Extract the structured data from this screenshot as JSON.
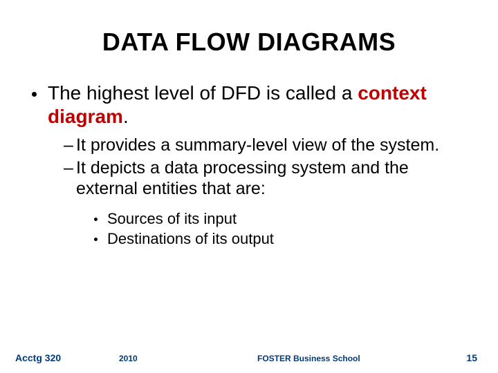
{
  "title": "DATA FLOW DIAGRAMS",
  "bullet1_pre": "The highest level of DFD is called a ",
  "bullet1_emph": "context diagram",
  "bullet1_post": ".",
  "sub": {
    "dash": "–",
    "item1": "It provides a summary-level view of the system.",
    "item2": "It depicts a data processing system and the external entities that are:"
  },
  "subsub": {
    "item1": "Sources of its input",
    "item2": "Destinations of its output"
  },
  "footer": {
    "course": "Acctg 320",
    "year": "2010",
    "school": "FOSTER Business School",
    "page": "15"
  }
}
